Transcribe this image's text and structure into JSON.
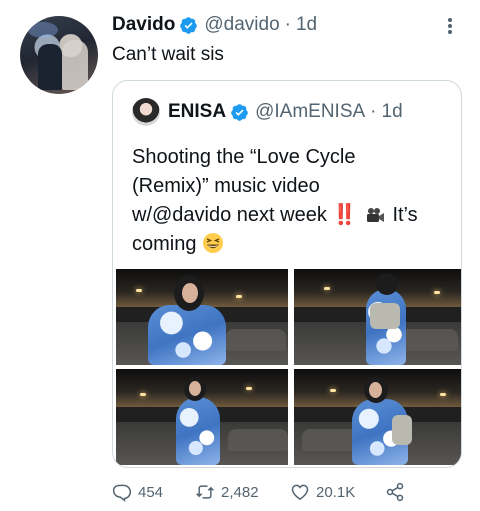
{
  "tweet": {
    "author_name": "Davido",
    "author_handle": "@davido",
    "separator": "·",
    "timestamp": "1d",
    "text": "Can’t wait sis"
  },
  "quoted_tweet": {
    "author_name": "ENISA",
    "author_handle": "@IAmENISA",
    "separator": "·",
    "timestamp": "1d",
    "text_line1": "Shooting the “Love Cycle",
    "text_line2": "(Remix)” music video",
    "text_line3_prefix": "w/@davido next week",
    "bangs": "‼️",
    "text_line3_suffix": "It’s",
    "text_line4": "coming",
    "media_count": 4
  },
  "actions": {
    "reply_count": "454",
    "retweet_count": "2,482",
    "like_count": "20.1K"
  },
  "icons": {
    "verified": "verified-badge-icon",
    "more": "more-options-icon",
    "reply": "reply-icon",
    "retweet": "retweet-icon",
    "like": "heart-icon",
    "share": "share-icon",
    "camera": "movie-camera-emoji",
    "laugh": "grinning-squinting-face-emoji"
  },
  "colors": {
    "verified_blue": "#1d9bf0",
    "secondary_text": "#536471",
    "bangs_red": "#e0245e"
  }
}
